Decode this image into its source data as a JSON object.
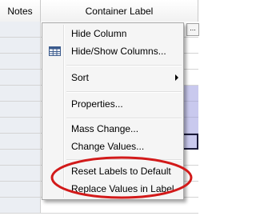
{
  "grid": {
    "columns": [
      "Notes",
      "Container Label"
    ],
    "more_button": "..."
  },
  "menu": {
    "items": [
      {
        "label": "Hide Column"
      },
      {
        "label": "Hide/Show Columns..."
      },
      {
        "label": "Sort"
      },
      {
        "label": "Properties..."
      },
      {
        "label": "Mass Change..."
      },
      {
        "label": "Change Values..."
      },
      {
        "label": "Reset Labels to Default"
      },
      {
        "label": "Replace Values in Label"
      }
    ]
  },
  "colors": {
    "highlight_ring": "#d21a1a",
    "right_column_fill": "#c9c9ee",
    "notes_column_fill": "#ebeef3"
  }
}
